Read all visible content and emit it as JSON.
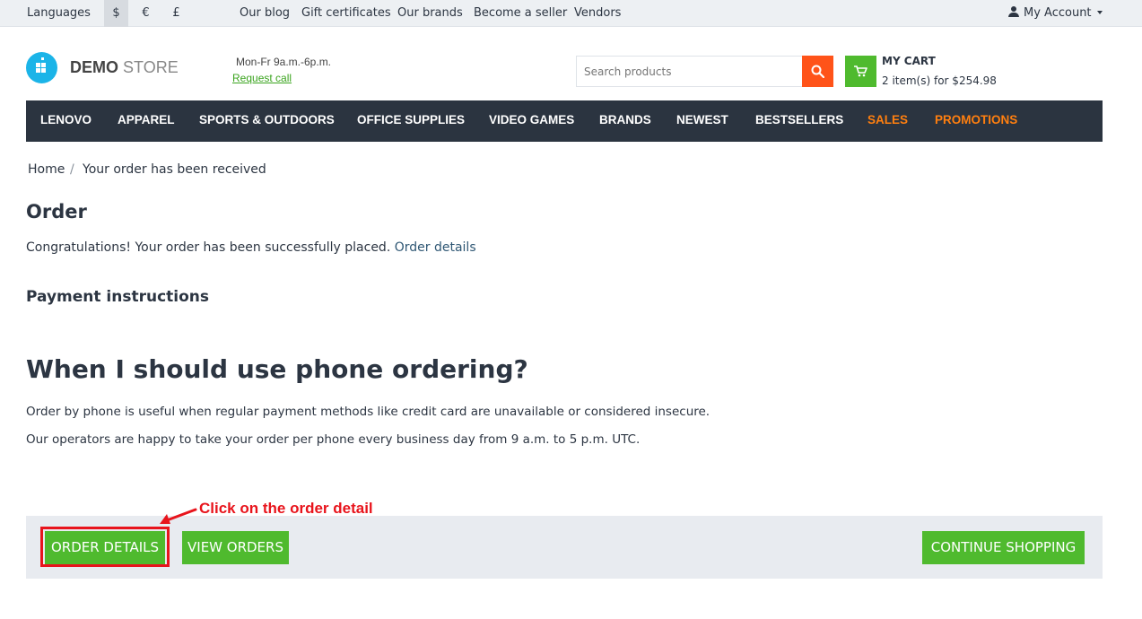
{
  "topbar": {
    "languages": "Languages",
    "currencies": [
      "$",
      "€",
      "£"
    ],
    "links": [
      "Our blog",
      "Gift certificates",
      "Our brands",
      "Become a seller",
      "Vendors"
    ],
    "account": "My Account"
  },
  "header": {
    "logo_bold": "DEMO",
    "logo_light": "STORE",
    "hours": "Mon-Fr 9a.m.-6p.m.",
    "request_call": "Request call",
    "search_placeholder": "Search products",
    "cart_title": "MY CART",
    "cart_summary": "2 item(s) for $254.98"
  },
  "nav": {
    "items": [
      "LENOVO",
      "APPAREL",
      "SPORTS & OUTDOORS",
      "OFFICE SUPPLIES",
      "VIDEO GAMES",
      "BRANDS",
      "NEWEST",
      "BESTSELLERS",
      "SALES",
      "PROMOTIONS"
    ]
  },
  "breadcrumb": {
    "home": "Home",
    "separator": "/",
    "current": "Your order has been received"
  },
  "content": {
    "title": "Order",
    "congrats": "Congratulations! Your order has been successfully placed.",
    "order_details_link": "Order details",
    "payment_title": "Payment instructions",
    "phone_title": "When I should use phone ordering?",
    "paragraphs": [
      "Order by phone is useful when regular payment methods like credit card are unavailable or considered insecure.",
      "Our operators are happy to take your order per phone every business day from 9 a.m. to 5 p.m. UTC."
    ]
  },
  "actions": {
    "order_details": "ORDER DETAILS",
    "view_orders": "VIEW ORDERS",
    "continue_shopping": "CONTINUE SHOPPING"
  },
  "annotation": {
    "text": "Click on the order detail"
  },
  "colors": {
    "accent_green": "#4fba2e",
    "search_orange": "#ff5319",
    "nav_dark": "#2b3440",
    "nav_highlight": "#ff7f0f",
    "annotation_red": "#e8141c",
    "logo_blue": "#1bb4e8"
  }
}
